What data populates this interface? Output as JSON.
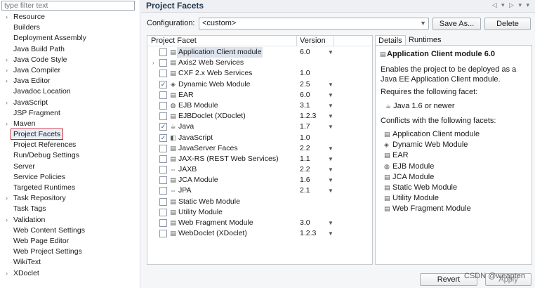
{
  "filter": {
    "placeholder": "type filter text"
  },
  "tree": [
    {
      "label": "Resource",
      "expandable": true
    },
    {
      "label": "Builders",
      "expandable": false
    },
    {
      "label": "Deployment Assembly",
      "expandable": false
    },
    {
      "label": "Java Build Path",
      "expandable": false
    },
    {
      "label": "Java Code Style",
      "expandable": true
    },
    {
      "label": "Java Compiler",
      "expandable": true
    },
    {
      "label": "Java Editor",
      "expandable": true
    },
    {
      "label": "Javadoc Location",
      "expandable": false
    },
    {
      "label": "JavaScript",
      "expandable": true
    },
    {
      "label": "JSP Fragment",
      "expandable": false
    },
    {
      "label": "Maven",
      "expandable": true
    },
    {
      "label": "Project Facets",
      "expandable": false,
      "selected": true
    },
    {
      "label": "Project References",
      "expandable": false
    },
    {
      "label": "Run/Debug Settings",
      "expandable": false
    },
    {
      "label": "Server",
      "expandable": false
    },
    {
      "label": "Service Policies",
      "expandable": false
    },
    {
      "label": "Targeted Runtimes",
      "expandable": false
    },
    {
      "label": "Task Repository",
      "expandable": true
    },
    {
      "label": "Task Tags",
      "expandable": false
    },
    {
      "label": "Validation",
      "expandable": true
    },
    {
      "label": "Web Content Settings",
      "expandable": false
    },
    {
      "label": "Web Page Editor",
      "expandable": false
    },
    {
      "label": "Web Project Settings",
      "expandable": false
    },
    {
      "label": "WikiText",
      "expandable": false
    },
    {
      "label": "XDoclet",
      "expandable": true
    }
  ],
  "header": {
    "title": "Project Facets"
  },
  "config": {
    "label": "Configuration:",
    "value": "<custom>",
    "save_as": "Save As...",
    "delete": "Delete"
  },
  "facet_table": {
    "col_facet": "Project Facet",
    "col_version": "Version",
    "rows": [
      {
        "name": "Application Client module",
        "version": "6.0",
        "checked": false,
        "icon": "page",
        "dropdown": true,
        "highlight": true
      },
      {
        "name": "Axis2 Web Services",
        "version": "",
        "checked": false,
        "icon": "page",
        "dropdown": false,
        "expandable": true
      },
      {
        "name": "CXF 2.x Web Services",
        "version": "1.0",
        "checked": false,
        "icon": "page",
        "dropdown": false
      },
      {
        "name": "Dynamic Web Module",
        "version": "2.5",
        "checked": true,
        "icon": "web",
        "dropdown": true
      },
      {
        "name": "EAR",
        "version": "6.0",
        "checked": false,
        "icon": "page",
        "dropdown": true
      },
      {
        "name": "EJB Module",
        "version": "3.1",
        "checked": false,
        "icon": "bean",
        "dropdown": true
      },
      {
        "name": "EJBDoclet (XDoclet)",
        "version": "1.2.3",
        "checked": false,
        "icon": "page",
        "dropdown": true
      },
      {
        "name": "Java",
        "version": "1.7",
        "checked": true,
        "icon": "java",
        "dropdown": true
      },
      {
        "name": "JavaScript",
        "version": "1.0",
        "checked": true,
        "icon": "js",
        "dropdown": false
      },
      {
        "name": "JavaServer Faces",
        "version": "2.2",
        "checked": false,
        "icon": "page",
        "dropdown": true
      },
      {
        "name": "JAX-RS (REST Web Services)",
        "version": "1.1",
        "checked": false,
        "icon": "page",
        "dropdown": true
      },
      {
        "name": "JAXB",
        "version": "2.2",
        "checked": false,
        "icon": "arrows",
        "dropdown": true
      },
      {
        "name": "JCA Module",
        "version": "1.6",
        "checked": false,
        "icon": "page",
        "dropdown": true
      },
      {
        "name": "JPA",
        "version": "2.1",
        "checked": false,
        "icon": "arrows",
        "dropdown": true
      },
      {
        "name": "Static Web Module",
        "version": "",
        "checked": false,
        "icon": "page",
        "dropdown": false
      },
      {
        "name": "Utility Module",
        "version": "",
        "checked": false,
        "icon": "page",
        "dropdown": false
      },
      {
        "name": "Web Fragment Module",
        "version": "3.0",
        "checked": false,
        "icon": "page",
        "dropdown": true
      },
      {
        "name": "WebDoclet (XDoclet)",
        "version": "1.2.3",
        "checked": false,
        "icon": "page",
        "dropdown": true
      }
    ]
  },
  "details": {
    "tab_details": "Details",
    "tab_runtimes": "Runtimes",
    "title": "Application Client module 6.0",
    "description": "Enables the project to be deployed as a Java EE Application Client module.",
    "requires_heading": "Requires the following facet:",
    "requires_item": "Java 1.6 or newer",
    "conflicts_heading": "Conflicts with the following facets:",
    "conflicts": [
      {
        "label": "Application Client module",
        "icon": "page"
      },
      {
        "label": "Dynamic Web Module",
        "icon": "web"
      },
      {
        "label": "EAR",
        "icon": "page"
      },
      {
        "label": "EJB Module",
        "icon": "bean"
      },
      {
        "label": "JCA Module",
        "icon": "page"
      },
      {
        "label": "Static Web Module",
        "icon": "page"
      },
      {
        "label": "Utility Module",
        "icon": "page"
      },
      {
        "label": "Web Fragment Module",
        "icon": "page"
      }
    ]
  },
  "footer": {
    "revert": "Revert",
    "apply": "Apply",
    "watermark": "CSDN @weapten"
  },
  "colors": {
    "selection_outline": "#c0192a",
    "title_text": "#23364f"
  }
}
